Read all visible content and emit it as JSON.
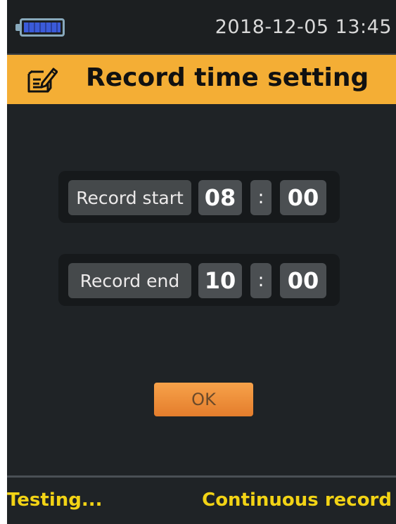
{
  "status_bar": {
    "battery_icon": "battery-icon",
    "datetime": "2018-12-05 13:45"
  },
  "header": {
    "icon": "notepad-edit-icon",
    "title": "Record time setting"
  },
  "record_start": {
    "label": "Record start",
    "hour": "08",
    "separator": ":",
    "minute": "00"
  },
  "record_end": {
    "label": "Record end",
    "hour": "10",
    "separator": ":",
    "minute": "00"
  },
  "ok_button": {
    "label": "OK"
  },
  "footer": {
    "left_status": "Testing...",
    "right_status": "Continuous record"
  },
  "colors": {
    "header_background": "#f4ae35",
    "screen_background": "#1f2326",
    "footer_text": "#f2d315",
    "ok_button": "#e88f39"
  }
}
